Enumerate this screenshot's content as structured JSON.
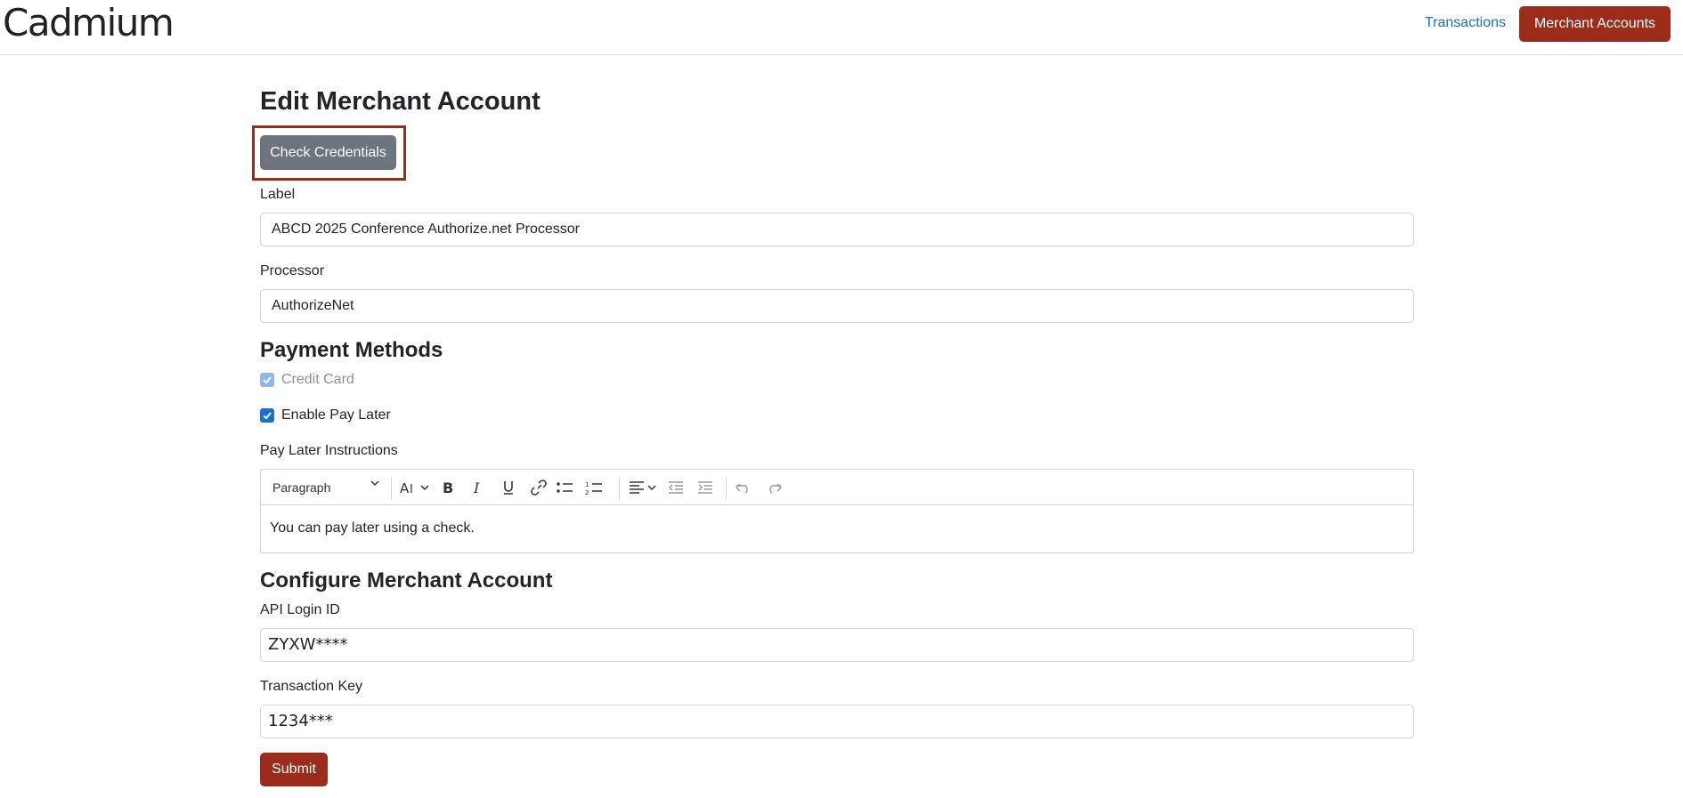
{
  "app": {
    "brand": "Cadmium"
  },
  "nav": {
    "transactions": "Transactions",
    "merchant_accounts": "Merchant Accounts"
  },
  "page": {
    "title": "Edit Merchant Account",
    "check_credentials": "Check Credentials"
  },
  "form": {
    "label": {
      "label": "Label",
      "value": "ABCD 2025 Conference Authorize.net Processor"
    },
    "processor": {
      "label": "Processor",
      "value": "AuthorizeNet"
    }
  },
  "payment_methods": {
    "heading": "Payment Methods",
    "credit_card": {
      "label": "Credit Card",
      "checked": true,
      "disabled": true
    },
    "pay_later": {
      "label": "Enable Pay Later",
      "checked": true
    }
  },
  "pay_later_instructions": {
    "label": "Pay Later Instructions",
    "toolbar": {
      "paragraph": "Paragraph",
      "icons": [
        "font-size-icon",
        "bold-icon",
        "italic-icon",
        "underline-icon",
        "link-icon",
        "bulleted-list-icon",
        "numbered-list-icon",
        "align-icon",
        "outdent-icon",
        "indent-icon",
        "undo-icon",
        "redo-icon"
      ]
    },
    "content": "You can pay later using a check."
  },
  "configure": {
    "heading": "Configure Merchant Account",
    "api_login_id": {
      "label": "API Login ID",
      "value": "ZYXW****"
    },
    "transaction_key": {
      "label": "Transaction Key",
      "value": "1234***"
    }
  },
  "actions": {
    "submit": "Submit"
  },
  "colors": {
    "brand": "#9b2c1c",
    "link": "#1a6fd1",
    "secondary": "#6c757d"
  }
}
